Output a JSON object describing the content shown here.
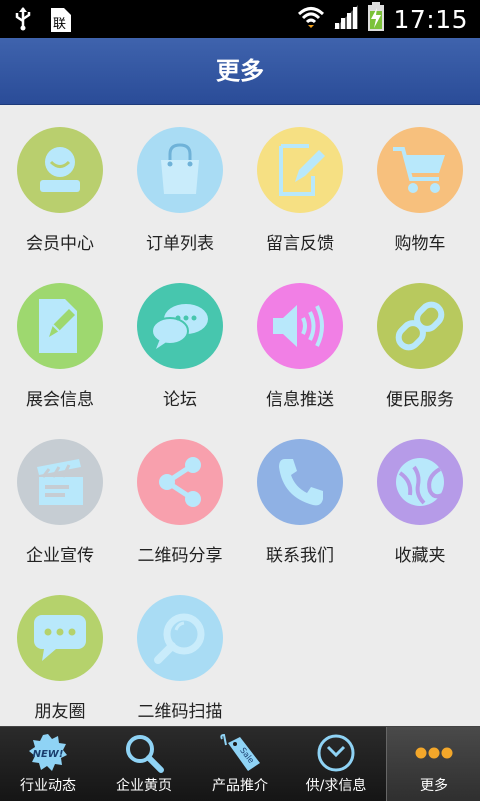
{
  "status_bar": {
    "time": "17:15",
    "icons": [
      "usb-icon",
      "sim-icon",
      "wifi-icon",
      "signal-icon",
      "battery-charging-icon"
    ]
  },
  "header": {
    "title": "更多"
  },
  "grid": {
    "items": [
      {
        "label": "会员中心",
        "icon": "member-icon",
        "color": "#b9cf6e"
      },
      {
        "label": "订单列表",
        "icon": "shopping-bag-icon",
        "color": "#a9dcf4"
      },
      {
        "label": "留言反馈",
        "icon": "edit-note-icon",
        "color": "#f6e083"
      },
      {
        "label": "购物车",
        "icon": "cart-icon",
        "color": "#f7c07d"
      },
      {
        "label": "展会信息",
        "icon": "document-pen-icon",
        "color": "#9ed86f"
      },
      {
        "label": "论坛",
        "icon": "chat-bubbles-icon",
        "color": "#47c6ae"
      },
      {
        "label": "信息推送",
        "icon": "speaker-icon",
        "color": "#f17fe5"
      },
      {
        "label": "便民服务",
        "icon": "link-icon",
        "color": "#b8c95e"
      },
      {
        "label": "企业宣传",
        "icon": "clapperboard-icon",
        "color": "#c6cdd3"
      },
      {
        "label": "二维码分享",
        "icon": "share-icon",
        "color": "#f8a0ad"
      },
      {
        "label": "联系我们",
        "icon": "phone-icon",
        "color": "#8fb1e4"
      },
      {
        "label": "收藏夹",
        "icon": "favorites-icon",
        "color": "#b69be8"
      },
      {
        "label": "朋友圈",
        "icon": "message-icon",
        "color": "#b5d26c"
      },
      {
        "label": "二维码扫描",
        "icon": "magnifier-icon",
        "color": "#a9dcf4"
      }
    ]
  },
  "tabbar": {
    "items": [
      {
        "label": "行业动态",
        "icon": "new-badge-icon",
        "active": false
      },
      {
        "label": "企业黄页",
        "icon": "search-icon",
        "active": false
      },
      {
        "label": "产品推介",
        "icon": "sale-tag-icon",
        "active": false
      },
      {
        "label": "供/求信息",
        "icon": "compass-icon",
        "active": false
      },
      {
        "label": "更多",
        "icon": "more-dots-icon",
        "active": true
      }
    ]
  },
  "colors": {
    "header_bg": "#2f55a3",
    "icon_glyph": "#b8e8fb"
  }
}
